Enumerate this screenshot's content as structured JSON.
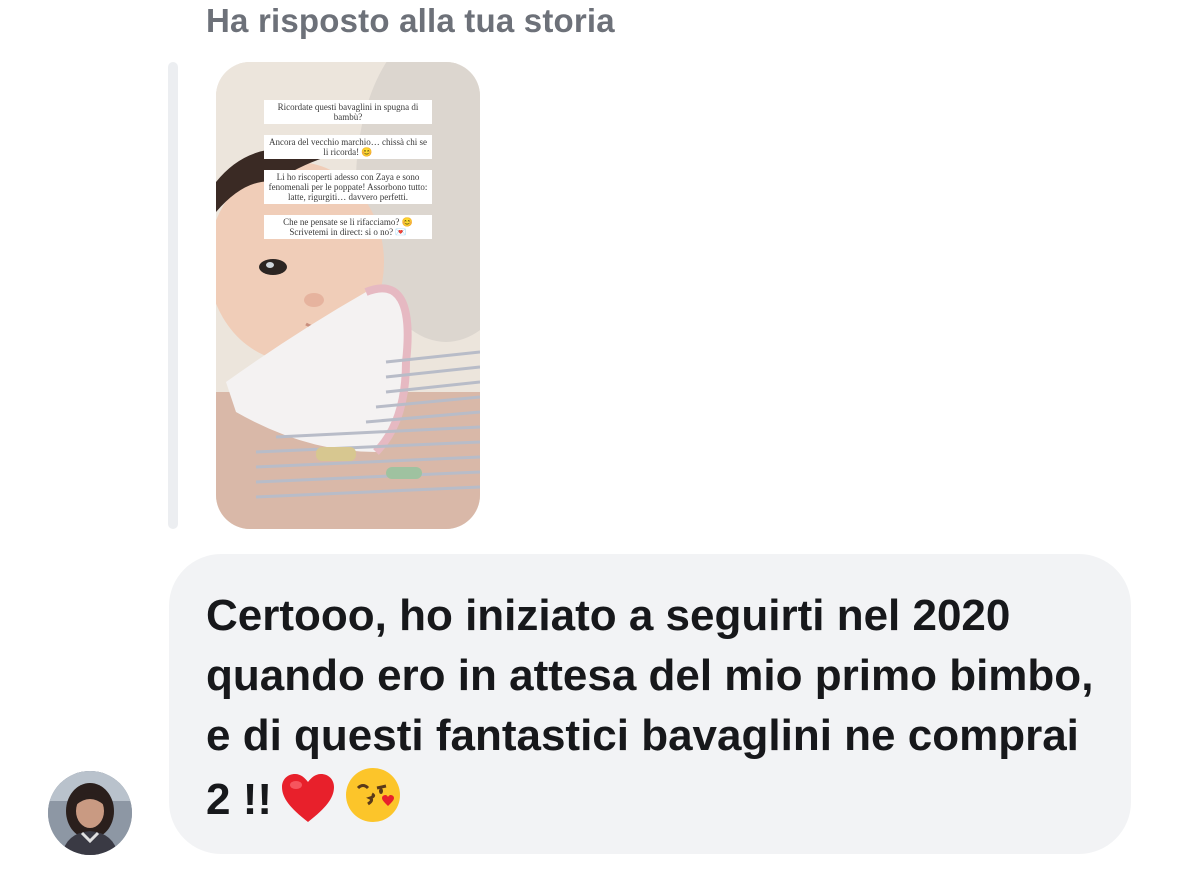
{
  "reply_header": "Ha risposto alla tua storia",
  "story": {
    "captions": [
      "Ricordate questi bavaglini in spugna di bambù?",
      "Ancora del vecchio marchio… chissà chi se li ricorda! 😊",
      "Li ho riscoperti adesso con Zaya e sono fenomenali per le poppate! Assorbono tutto: latte, rigurgiti… davvero perfetti.",
      "Che ne pensate se li rifacciamo? 😊 Scrivetemi in direct: si o no? 💌"
    ]
  },
  "message": {
    "text": "Certooo, ho iniziato a seguirti nel 2020 quando ero in attesa del mio primo bimbo, e di questi fantastici bavaglini ne comprai 2 !!",
    "emojis": [
      "heart-icon",
      "kiss-face-icon"
    ]
  },
  "colors": {
    "bubble_bg": "#f2f3f5",
    "header_text": "#6d7179",
    "message_text": "#17181b",
    "quote_bar": "#eceef1"
  }
}
